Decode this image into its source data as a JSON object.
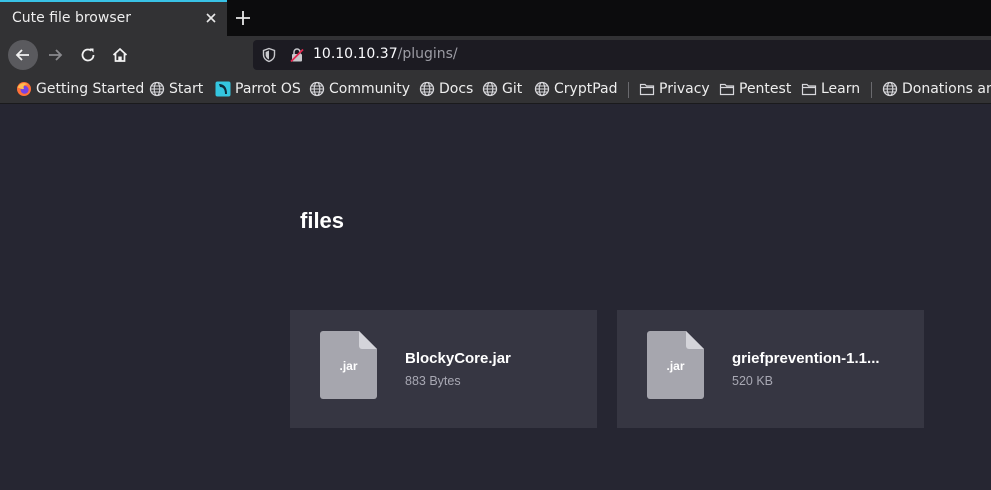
{
  "browser": {
    "tab": {
      "title": "Cute file browser"
    },
    "url": {
      "host": "10.10.10.37",
      "path": "/plugins/"
    },
    "bookmarks": [
      {
        "label": "Getting Started",
        "icon": "firefox-icon"
      },
      {
        "label": "Start",
        "icon": "globe-icon"
      },
      {
        "label": "Parrot OS",
        "icon": "parrot-icon"
      },
      {
        "label": "Community",
        "icon": "globe-icon"
      },
      {
        "label": "Docs",
        "icon": "globe-icon"
      },
      {
        "label": "Git",
        "icon": "globe-icon"
      },
      {
        "label": "CryptPad",
        "icon": "globe-icon"
      },
      {
        "label": "Privacy",
        "icon": "folder-icon"
      },
      {
        "label": "Pentest",
        "icon": "folder-icon"
      },
      {
        "label": "Learn",
        "icon": "folder-icon"
      },
      {
        "label": "Donations an",
        "icon": "globe-icon"
      }
    ],
    "accent_color": "#39c2e6"
  },
  "page": {
    "heading": "files",
    "files": [
      {
        "name": "BlockyCore.jar",
        "type": ".jar",
        "size": "883 Bytes"
      },
      {
        "name": "griefprevention-1.1...",
        "type": ".jar",
        "size": "520 KB"
      }
    ],
    "colors": {
      "background": "#262632",
      "card": "#363642",
      "file_icon": "#a6a6ae"
    }
  }
}
